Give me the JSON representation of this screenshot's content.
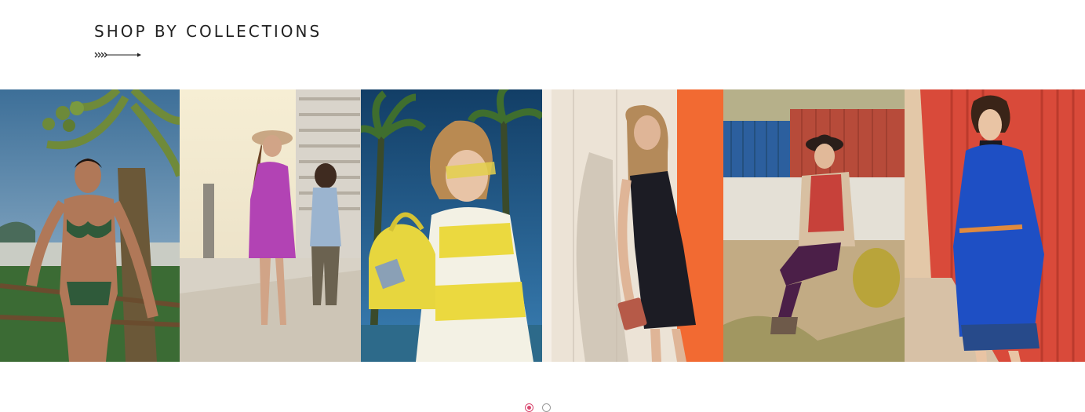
{
  "section": {
    "title": "SHOP BY COLLECTIONS",
    "decoration_icon": "arrow-right-icon"
  },
  "collections": [
    {
      "photo": "beach-swimwear-model",
      "colors": {
        "sky": "#4f7fa6",
        "accent": "#2d5a30"
      }
    },
    {
      "photo": "pink-shirt-dress-street",
      "colors": {
        "sky": "#f3ead0",
        "accent": "#b243b4"
      }
    },
    {
      "photo": "yellow-bag-sunglasses",
      "colors": {
        "sky": "#1d5b86",
        "accent": "#e7d63e"
      }
    },
    {
      "photo": "black-dress-wall",
      "colors": {
        "sky": "#ebe1d3",
        "accent": "#f26a32"
      }
    },
    {
      "photo": "containers-plaid-shirt",
      "colors": {
        "sky": "#2c5f9e",
        "accent": "#b74b3a"
      }
    },
    {
      "photo": "blue-coat-red-wall",
      "colors": {
        "sky": "#d94a3a",
        "accent": "#1e4fc4"
      }
    }
  ],
  "carousel": {
    "pages": 2,
    "active_page": 1,
    "active_color": "#d9486f",
    "inactive_color": "#9a9a9a"
  }
}
